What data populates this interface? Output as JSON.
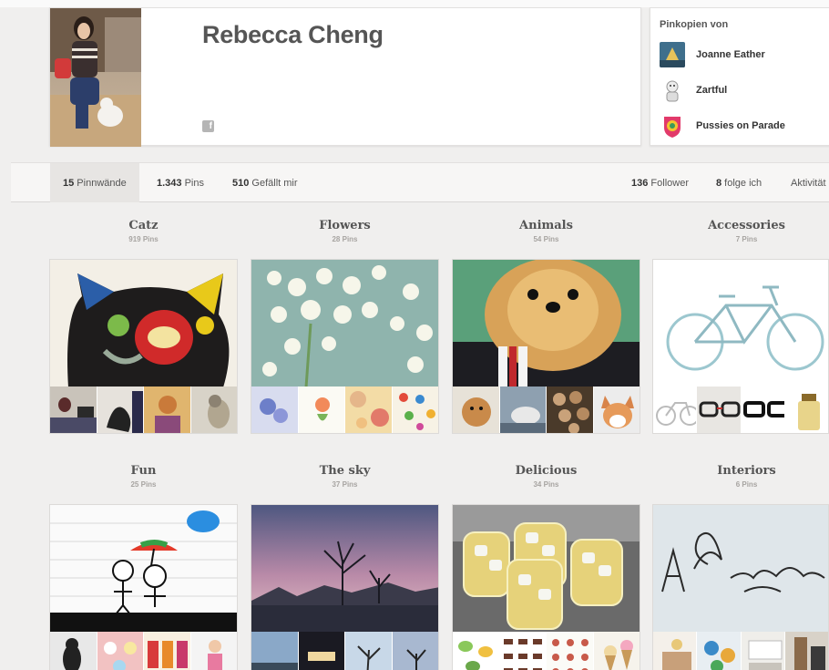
{
  "profile": {
    "name": "Rebecca Cheng"
  },
  "repins": {
    "title": "Pinkopien von",
    "users": [
      {
        "name": "Joanne Eather"
      },
      {
        "name": "Zartful"
      },
      {
        "name": "Pussies on Parade"
      }
    ]
  },
  "tabs": {
    "boards_count": "15",
    "boards_label": " Pinnwände",
    "pins_count": "1.343",
    "pins_label": " Pins",
    "likes_count": "510",
    "likes_label": " Gefällt mir",
    "followers_count": "136",
    "followers_label": " Follower",
    "following_count": "8",
    "following_label": " folge ich",
    "activity_label": "Aktivität"
  },
  "boards": [
    {
      "title": "Catz",
      "count": "919 Pins"
    },
    {
      "title": "Flowers",
      "count": "28 Pins"
    },
    {
      "title": "Animals",
      "count": "54 Pins"
    },
    {
      "title": "Accessories",
      "count": "7 Pins"
    },
    {
      "title": "Fun",
      "count": "25 Pins"
    },
    {
      "title": "The sky",
      "count": "37 Pins"
    },
    {
      "title": "Delicious",
      "count": "34 Pins"
    },
    {
      "title": "Interiors",
      "count": "6 Pins"
    }
  ],
  "icons": {
    "facebook": "facebook-icon"
  },
  "colors": {
    "background": "#f0efee",
    "card": "#ffffff",
    "text_dark": "#333333",
    "count_gray": "#a7a4a1"
  }
}
